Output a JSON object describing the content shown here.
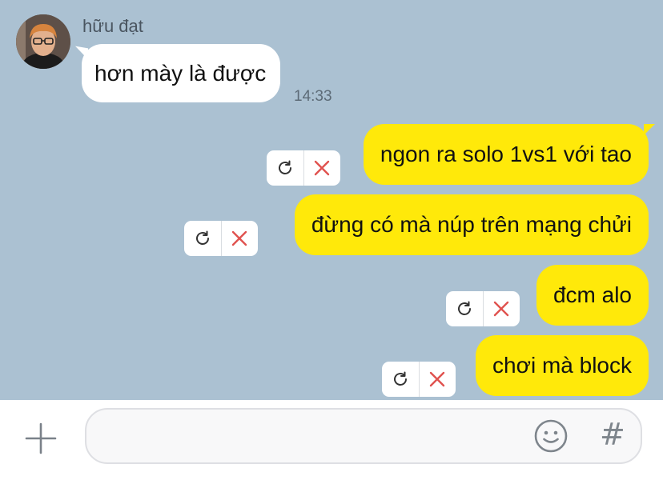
{
  "conversation": {
    "sender_name": "hữu đạt",
    "incoming": {
      "text": "hơn mày là được",
      "time": "14:33"
    },
    "outgoing": [
      {
        "text": "ngon ra solo 1vs1 với tao",
        "status": "failed"
      },
      {
        "text": "đừng có mà núp trên mạng chửi",
        "status": "failed"
      },
      {
        "text": "đcm alo",
        "status": "failed"
      },
      {
        "text": "chơi mà block",
        "status": "failed"
      }
    ]
  },
  "composer": {
    "placeholder": "",
    "icons": [
      "plus-icon",
      "emoji-icon",
      "hashtag-icon"
    ],
    "hash_glyph": "#"
  },
  "colors": {
    "chat_background": "#abc1d2",
    "outgoing_bubble": "#ffe90a",
    "incoming_bubble": "#ffffff",
    "cancel_x": "#e0524f"
  }
}
